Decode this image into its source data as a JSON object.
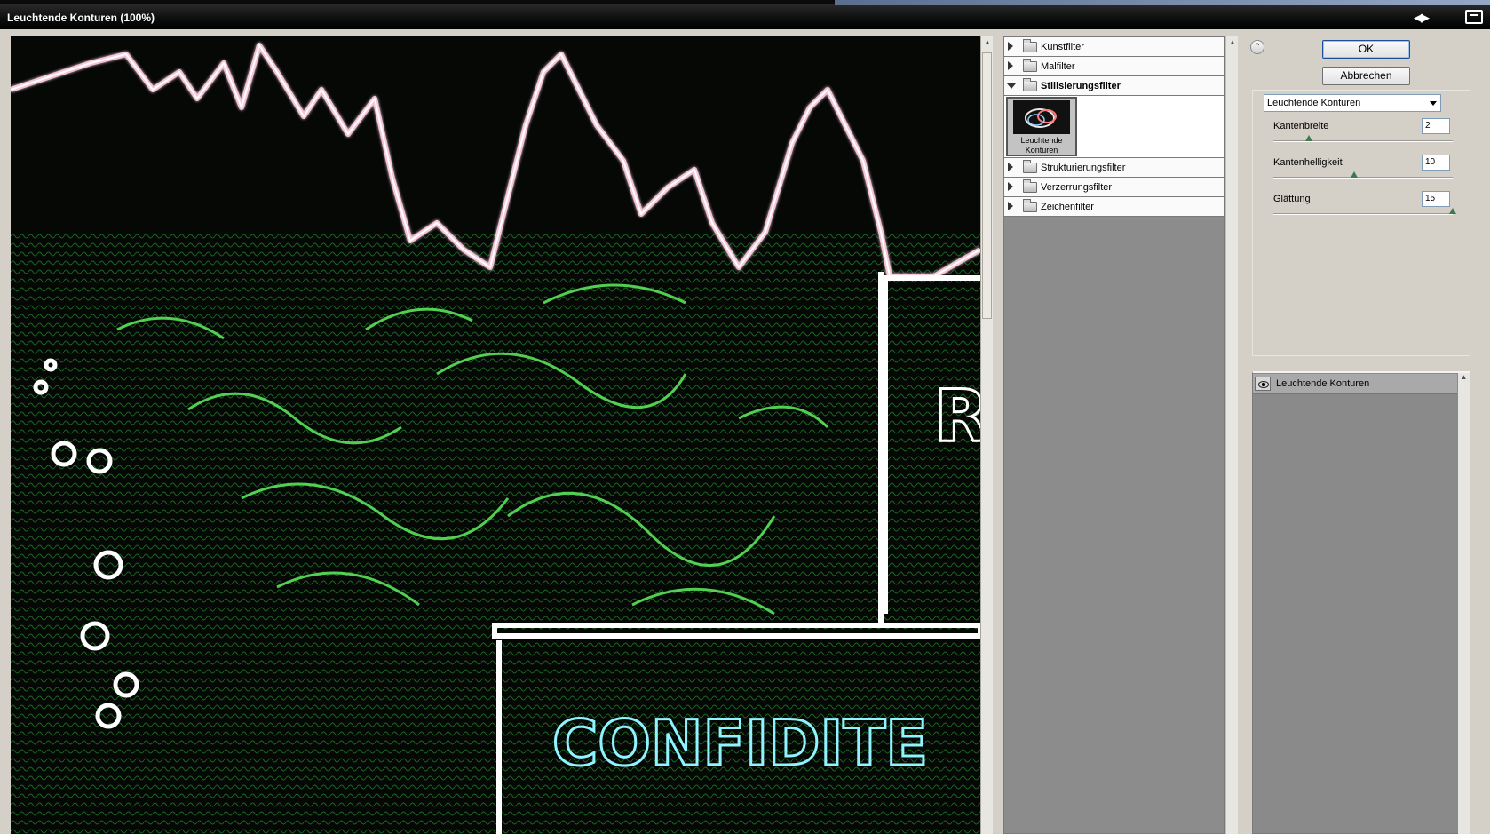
{
  "window": {
    "title": "Leuchtende Konturen (100%)"
  },
  "buttons": {
    "ok": "OK",
    "cancel": "Abbrechen"
  },
  "categories": [
    {
      "label": "Kunstfilter",
      "expanded": false
    },
    {
      "label": "Malfilter",
      "expanded": false
    },
    {
      "label": "Stilisierungsfilter",
      "expanded": true
    },
    {
      "label": "Strukturierungsfilter",
      "expanded": false
    },
    {
      "label": "Verzerrungsfilter",
      "expanded": false
    },
    {
      "label": "Zeichenfilter",
      "expanded": false
    }
  ],
  "selected_filter": {
    "label_line1": "Leuchtende",
    "label_line2": "Konturen"
  },
  "settings": {
    "filter_select": "Leuchtende Konturen",
    "params": [
      {
        "label": "Kantenbreite",
        "value": "2",
        "fraction": 0.2
      },
      {
        "label": "Kantenhelligkeit",
        "value": "10",
        "fraction": 0.45
      },
      {
        "label": "Glättung",
        "value": "15",
        "fraction": 1.0
      }
    ]
  },
  "layers": [
    {
      "label": "Leuchtende Konturen",
      "visible": true
    }
  ],
  "preview": {
    "text": "CONFIDITE"
  }
}
